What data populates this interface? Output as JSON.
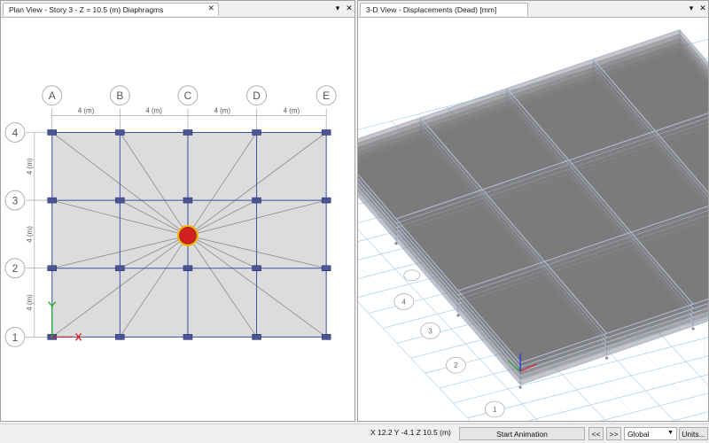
{
  "left_view": {
    "title": "Plan View - Story 3 - Z = 10.5 (m)  Diaphragms",
    "grid_x": [
      "A",
      "B",
      "C",
      "D",
      "E"
    ],
    "grid_y": [
      "4",
      "3",
      "2",
      "1"
    ],
    "spacing_x": [
      "4 (m)",
      "4 (m)",
      "4 (m)",
      "4 (m)"
    ],
    "spacing_y": [
      "4 (m)",
      "4 (m)",
      "4 (m)"
    ],
    "colors": {
      "slab": "#dcdcdc",
      "beam": "#3a4fa8",
      "column": "#4a5694",
      "diaphragm_fill": "#d21f1f",
      "diaphragm_ring": "#f0b400",
      "axis_x": "#e02020",
      "axis_y": "#20b020"
    }
  },
  "right_view": {
    "title": "3-D View  - Displacements (Dead)  [mm]",
    "grid_labels": [
      "4",
      "3",
      "2",
      "1"
    ]
  },
  "window_buttons": {
    "dropdown": "▾",
    "close": "✕"
  },
  "status": {
    "coordinates": "X 12.2  Y -4.1  Z 10.5 (m)",
    "start_animation": "Start Animation",
    "prev": "<<",
    "next": ">>",
    "coord_system": "Global",
    "units": "Units..."
  }
}
